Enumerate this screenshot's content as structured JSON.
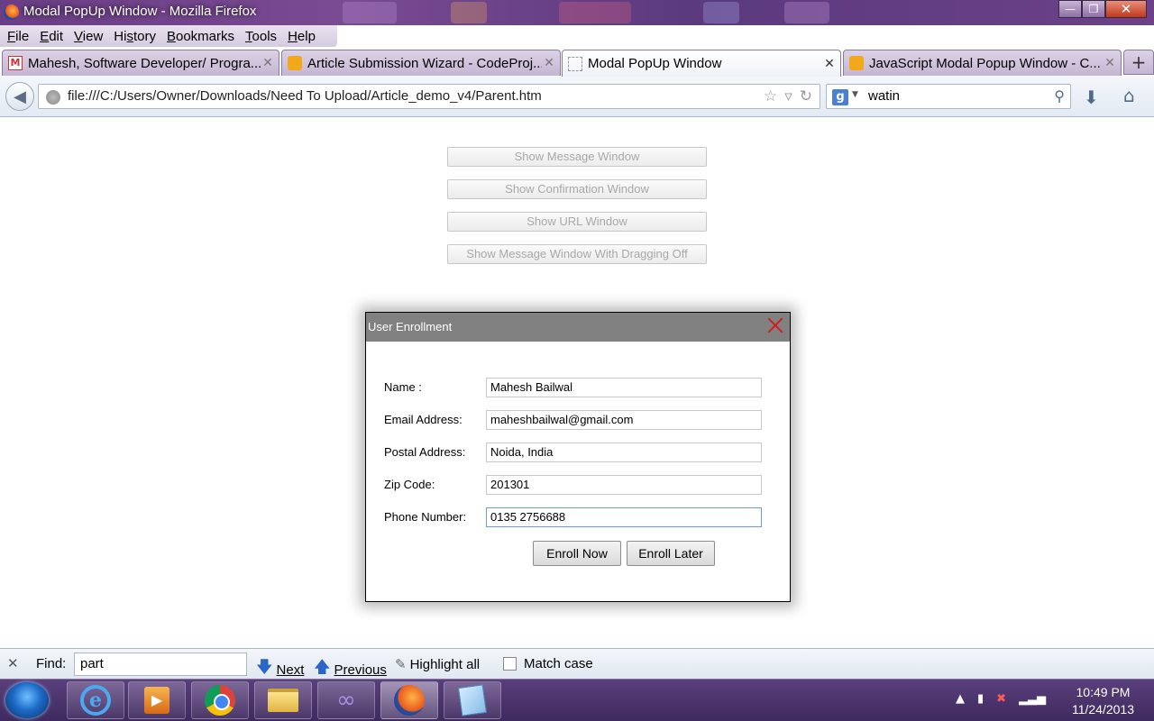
{
  "window": {
    "title": "Modal PopUp Window - Mozilla Firefox",
    "controls": {
      "minimize": "—",
      "restore": "❐",
      "close": "✕"
    }
  },
  "menu": {
    "items": [
      {
        "label": "File",
        "key": "F",
        "rest": "ile"
      },
      {
        "label": "Edit",
        "key": "E",
        "rest": "dit"
      },
      {
        "label": "View",
        "key": "V",
        "rest": "iew"
      },
      {
        "label": "History",
        "key": "s",
        "pre": "Hi",
        "rest": "tory"
      },
      {
        "label": "Bookmarks",
        "key": "B",
        "rest": "ookmarks"
      },
      {
        "label": "Tools",
        "key": "T",
        "rest": "ools"
      },
      {
        "label": "Help",
        "key": "H",
        "rest": "elp"
      }
    ]
  },
  "tabs": [
    {
      "label": "Mahesh, Software Developer/ Progra...",
      "icon": "gmail-icon",
      "active": false
    },
    {
      "label": "Article Submission Wizard - CodeProj...",
      "icon": "codeproject-icon",
      "active": false
    },
    {
      "label": "Modal PopUp Window",
      "icon": "blank-page-icon",
      "active": true
    },
    {
      "label": "JavaScript Modal Popup Window - C...",
      "icon": "codeproject-icon",
      "active": false
    }
  ],
  "tab_close_glyph": "✕",
  "new_tab_glyph": "+",
  "nav": {
    "url": "file:///C:/Users/Owner/Downloads/Need To Upload/Article_demo_v4/Parent.htm",
    "search_engine": "g",
    "search_value": "watin"
  },
  "page_buttons": [
    "Show Message Window",
    "Show Confirmation Window",
    "Show URL Window",
    "Show Message Window With Dragging Off"
  ],
  "modal": {
    "title": "User Enrollment",
    "fields": [
      {
        "label": "Name :",
        "value": "Mahesh Bailwal"
      },
      {
        "label": "Email Address:",
        "value": "maheshbailwal@gmail.com"
      },
      {
        "label": "Postal Address:",
        "value": "Noida, India"
      },
      {
        "label": "Zip Code:",
        "value": "201301"
      },
      {
        "label": "Phone Number:",
        "value": "0135 2756688"
      }
    ],
    "enroll_now": "Enroll Now",
    "enroll_later": "Enroll Later"
  },
  "find": {
    "label": "Find:",
    "value": "part",
    "next": "Next",
    "previous": "Previous",
    "highlight_all": "Highlight all",
    "match_case": "Match case"
  },
  "taskbar": {
    "time": "10:49 PM",
    "date": "11/24/2013"
  }
}
